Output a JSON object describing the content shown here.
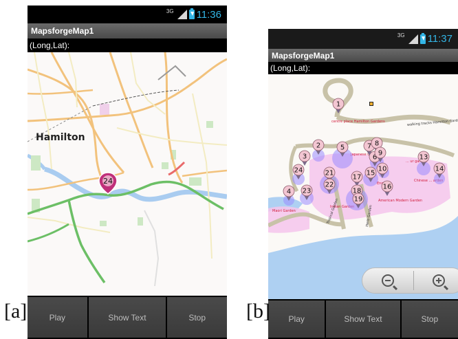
{
  "labels": {
    "a": "[a]",
    "b": "[b]"
  },
  "statusbar": {
    "network": "3G",
    "time_a": "11:36",
    "time_b": "11:37"
  },
  "app": {
    "title": "MapsforgeMap1",
    "coords_label": "(Long,Lat):"
  },
  "buttons": {
    "play": "Play",
    "show_text": "Show Text",
    "stop": "Stop"
  },
  "map_a": {
    "city_label": "Hamilton",
    "marker_number": "24",
    "marker_color": "#c0307a",
    "road_colors": {
      "main": "#f2c27c",
      "minor": "#fff2a0",
      "green_route": "#6cbf66",
      "river": "#a9ccf0"
    }
  },
  "map_b": {
    "labels": {
      "centre": "centre place Hamilton Gardens",
      "walking": "walking tracks Hamilton Gardens",
      "japanese": "Japanese Garden",
      "garden_right": "... ur garden",
      "chinese": "Chinese ... arden",
      "english": "English",
      "indian": "Indian Garden",
      "american": "American Modern Garden",
      "maori": "Maori Garden",
      "tropical": "Tropical Garden",
      "herb": "Herb Garden"
    },
    "markers": [
      "1",
      "2",
      "3",
      "4",
      "5",
      "6",
      "7",
      "8",
      "9",
      "10",
      "13",
      "14",
      "15",
      "16",
      "17",
      "18",
      "19",
      "21",
      "22",
      "23",
      "24"
    ],
    "marker_fill": "#f3c6d2",
    "zone_fill": "#9b8cff"
  },
  "zoom": {
    "out_icon": "zoom-out-icon",
    "in_icon": "zoom-in-icon"
  }
}
